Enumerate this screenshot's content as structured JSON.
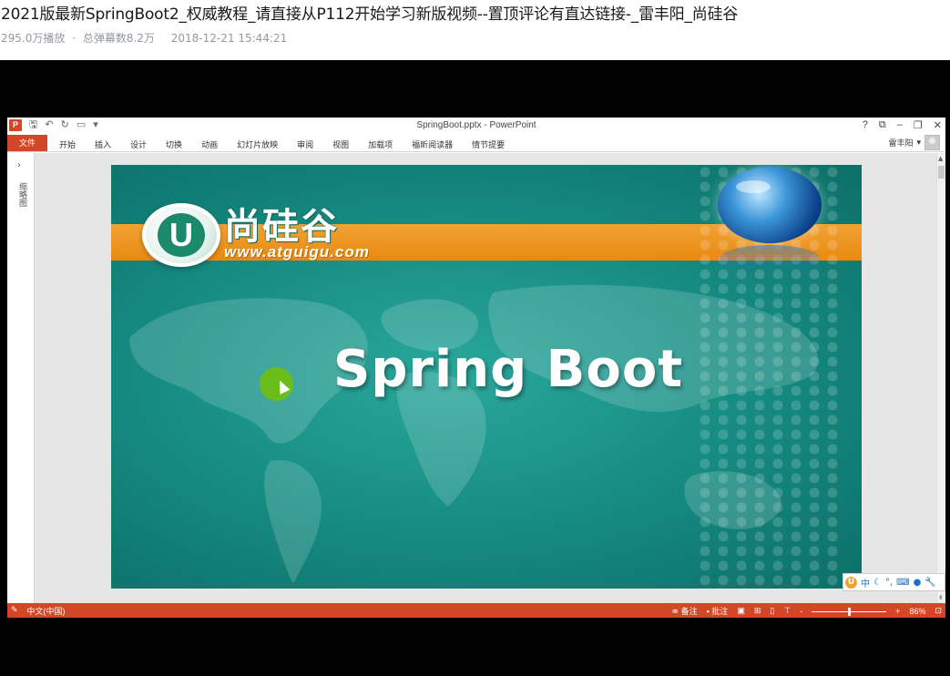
{
  "page": {
    "title": "2021版最新SpringBoot2_权威教程_请直接从P112开始学习新版视频--置顶评论有直达链接-_雷丰阳_尚硅谷",
    "views": "295.0万播放",
    "separator": "·",
    "danmaku": "总弹幕数8.2万",
    "date": "2018-12-21 15:44:21"
  },
  "ppt": {
    "logo_letter": "P",
    "qat": {
      "save_icon": "save-icon",
      "undo_icon": "undo-icon",
      "redo_icon": "redo-icon",
      "customize_icon": "customize-icon"
    },
    "doc_title": "SpringBoot.pptx - PowerPoint",
    "window_controls": [
      "?",
      "⧉",
      "–",
      "❐",
      "✕"
    ],
    "tab_file": "文件",
    "tabs": [
      "开始",
      "插入",
      "设计",
      "切换",
      "动画",
      "幻灯片放映",
      "审阅",
      "视图",
      "加载项",
      "福昕阅读器",
      "情节提要"
    ],
    "user": "雷丰阳",
    "thumb_pane_label": "缩略图",
    "slide": {
      "logo_letter": "U",
      "logo_cn": "尚硅谷",
      "logo_url": "www.atguigu.com",
      "title": "Spring Boot"
    },
    "ime": {
      "logo": "U",
      "mode": "中",
      "icons": [
        "moon-icon",
        "punctuation-icon",
        "keyboard-icon",
        "user-icon",
        "wrench-icon"
      ]
    },
    "status": {
      "language": "中文(中国)",
      "notes": "备注",
      "comments": "批注",
      "zoom_minus": "-",
      "zoom_plus": "+",
      "zoom": "86%"
    }
  }
}
